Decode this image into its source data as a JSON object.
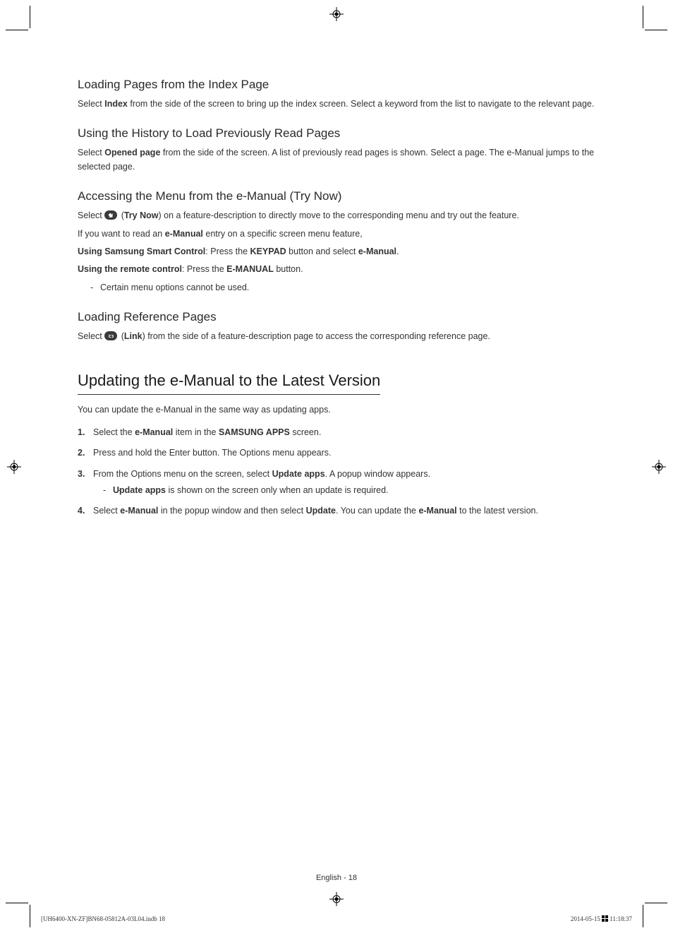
{
  "sections": {
    "s1": {
      "heading": "Loading Pages from the Index Page",
      "body": {
        "pre": "Select ",
        "bold1": "Index",
        "post": " from the side of the screen to bring up the index screen. Select a keyword from the list to navigate to the relevant page."
      }
    },
    "s2": {
      "heading": "Using the History to Load Previously Read Pages",
      "body": {
        "pre": "Select ",
        "bold1": "Opened page",
        "post": " from the side of the screen. A list of previously read pages is shown. Select a page. The e-Manual jumps to the selected page."
      }
    },
    "s3": {
      "heading": "Accessing the Menu from the e-Manual (Try Now)",
      "p1": {
        "pre": "Select ",
        "label": "Try Now",
        "post": ") on a feature-description to directly move to the corresponding menu and try out the feature."
      },
      "p2": {
        "pre": "If you want to read an ",
        "bold1": "e-Manual",
        "post": " entry on a specific screen menu feature,"
      },
      "p3": {
        "bold1": "Using Samsung Smart Control",
        "mid1": ": Press the ",
        "bold2": "KEYPAD",
        "mid2": " button and select ",
        "bold3": "e-Manual",
        "post": "."
      },
      "p4": {
        "bold1": "Using the remote control",
        "mid1": ": Press the ",
        "bold2": "E-MANUAL",
        "post": " button."
      },
      "note": "Certain menu options cannot be used."
    },
    "s4": {
      "heading": "Loading Reference Pages",
      "body": {
        "pre": "Select ",
        "label": "Link",
        "post": ") from the side of a feature-description page to access the corresponding reference page."
      }
    },
    "main": {
      "heading": "Updating the e-Manual to the Latest Version",
      "intro": "You can update the e-Manual in the same way as updating apps.",
      "steps": [
        {
          "pre": "Select the ",
          "b1": "e-Manual",
          "mid": " item in the ",
          "b2": "SAMSUNG APPS",
          "post": " screen."
        },
        {
          "text": "Press and hold the Enter button. The Options menu appears."
        },
        {
          "pre": "From the Options menu on the screen, select ",
          "b1": "Update apps",
          "post": ". A popup window appears.",
          "sub": {
            "b1": "Update apps",
            "post": " is shown on the screen only when an update is required."
          }
        },
        {
          "pre": "Select ",
          "b1": "e-Manual",
          "mid1": " in the popup window and then select ",
          "b2": "Update",
          "mid2": ". You can update the ",
          "b3": "e-Manual",
          "post": " to the latest version."
        }
      ]
    }
  },
  "footer": {
    "center": "English - 18",
    "left": "[UH6400-XN-ZF]BN68-05812A-03L04.indb   18",
    "right_date": "2014-05-15   ",
    "right_time": "11:18:37"
  }
}
